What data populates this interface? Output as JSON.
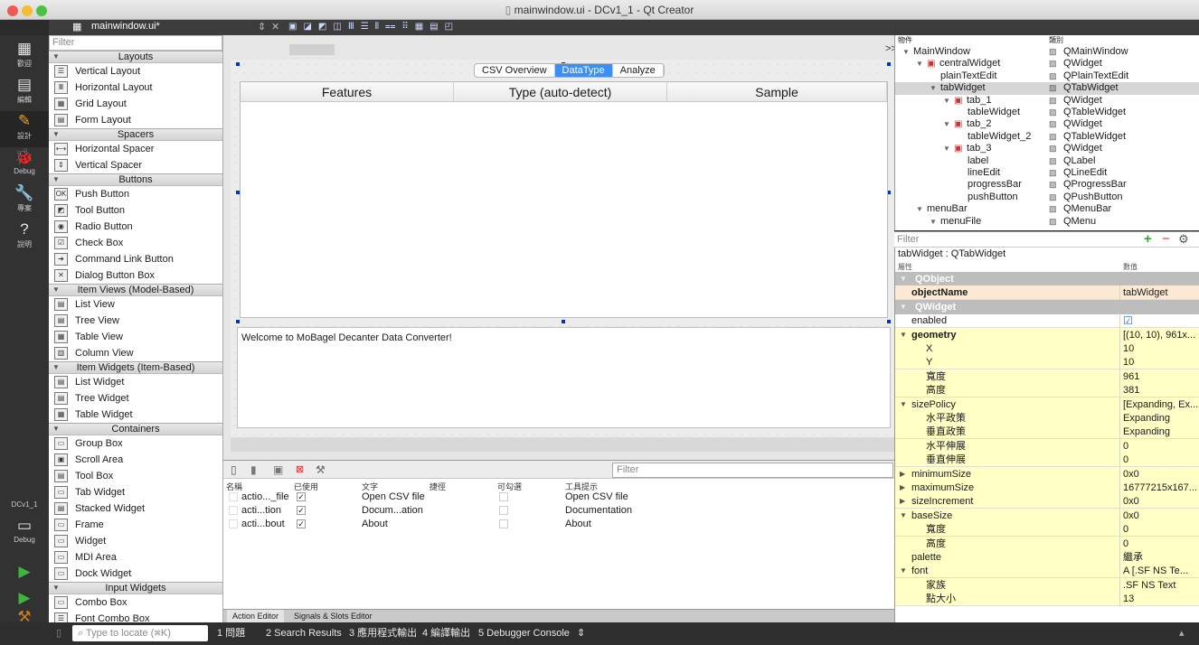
{
  "window": {
    "title": "mainwindow.ui - DCv1_1 - Qt Creator"
  },
  "editor_toolbar": {
    "filename": "mainwindow.ui*",
    "arrows": "⇕",
    "close": "✕"
  },
  "modes": [
    {
      "icon": "grid-icon",
      "glyph": "▦",
      "label": "歡迎"
    },
    {
      "icon": "edit-icon",
      "glyph": "▤",
      "label": "編輯"
    },
    {
      "icon": "design-icon",
      "glyph": "✎",
      "label": "設計"
    },
    {
      "icon": "debug-icon",
      "glyph": "🐞",
      "label": "Debug"
    },
    {
      "icon": "project-icon",
      "glyph": "🔧",
      "label": "專案"
    },
    {
      "icon": "help-icon",
      "glyph": "?",
      "label": "說明"
    }
  ],
  "kit": {
    "name": "DCv1_1",
    "mode": "Debug"
  },
  "widget_box": {
    "filter_placeholder": "Filter",
    "sections": [
      {
        "title": "Layouts",
        "items": [
          "Vertical Layout",
          "Horizontal Layout",
          "Grid Layout",
          "Form Layout"
        ]
      },
      {
        "title": "Spacers",
        "items": [
          "Horizontal Spacer",
          "Vertical Spacer"
        ]
      },
      {
        "title": "Buttons",
        "items": [
          "Push Button",
          "Tool Button",
          "Radio Button",
          "Check Box",
          "Command Link Button",
          "Dialog Button Box"
        ]
      },
      {
        "title": "Item Views (Model-Based)",
        "items": [
          "List View",
          "Tree View",
          "Table View",
          "Column View"
        ]
      },
      {
        "title": "Item Widgets (Item-Based)",
        "items": [
          "List Widget",
          "Tree Widget",
          "Table Widget"
        ]
      },
      {
        "title": "Containers",
        "items": [
          "Group Box",
          "Scroll Area",
          "Tool Box",
          "Tab Widget",
          "Stacked Widget",
          "Frame",
          "Widget",
          "MDI Area",
          "Dock Widget"
        ]
      },
      {
        "title": "Input Widgets",
        "items": [
          "Combo Box",
          "Font Combo Box"
        ]
      }
    ]
  },
  "form": {
    "tabs": [
      "CSV Overview",
      "DataType",
      "Analyze"
    ],
    "active_tab": "DataType",
    "table_headers": [
      "Features",
      "Type (auto-detect)",
      "Sample"
    ],
    "text_edit": "Welcome to MoBagel Decanter Data Converter!",
    "expand_arrow": ">>"
  },
  "action_editor": {
    "filter_placeholder": "Filter",
    "headers": [
      "名稱",
      "已使用",
      "文字",
      "捷徑",
      "可勾選",
      "工具提示"
    ],
    "rows": [
      {
        "name": "actio..._file",
        "used": "✓",
        "text": "Open CSV file",
        "tooltip": "Open CSV file"
      },
      {
        "name": "acti...tion",
        "used": "✓",
        "text": "Docum...ation",
        "tooltip": "Documentation"
      },
      {
        "name": "acti...bout",
        "used": "✓",
        "text": "About",
        "tooltip": "About"
      }
    ],
    "tabs": [
      "Action Editor",
      "Signals & Slots Editor"
    ]
  },
  "object_inspector": {
    "headers": [
      "物件",
      "類別"
    ],
    "rows": [
      {
        "name": "MainWindow",
        "cls": "QMainWindow",
        "depth": 0,
        "arrow": "▼"
      },
      {
        "name": "centralWidget",
        "cls": "QWidget",
        "depth": 1,
        "arrow": "▼"
      },
      {
        "name": "plainTextEdit",
        "cls": "QPlainTextEdit",
        "depth": 2,
        "arrow": ""
      },
      {
        "name": "tabWidget",
        "cls": "QTabWidget",
        "depth": 2,
        "arrow": "▼"
      },
      {
        "name": "tab_1",
        "cls": "QWidget",
        "depth": 3,
        "arrow": "▼"
      },
      {
        "name": "tableWidget",
        "cls": "QTableWidget",
        "depth": 4,
        "arrow": ""
      },
      {
        "name": "tab_2",
        "cls": "QWidget",
        "depth": 3,
        "arrow": "▼"
      },
      {
        "name": "tableWidget_2",
        "cls": "QTableWidget",
        "depth": 4,
        "arrow": ""
      },
      {
        "name": "tab_3",
        "cls": "QWidget",
        "depth": 3,
        "arrow": "▼"
      },
      {
        "name": "label",
        "cls": "QLabel",
        "depth": 4,
        "arrow": ""
      },
      {
        "name": "lineEdit",
        "cls": "QLineEdit",
        "depth": 4,
        "arrow": ""
      },
      {
        "name": "progressBar",
        "cls": "QProgressBar",
        "depth": 4,
        "arrow": ""
      },
      {
        "name": "pushButton",
        "cls": "QPushButton",
        "depth": 4,
        "arrow": ""
      },
      {
        "name": "menuBar",
        "cls": "QMenuBar",
        "depth": 1,
        "arrow": "▼"
      },
      {
        "name": "menuFile",
        "cls": "QMenu",
        "depth": 2,
        "arrow": "▼"
      }
    ],
    "selected": "tabWidget"
  },
  "property_editor": {
    "filter_placeholder": "Filter",
    "add": "+",
    "remove": "−",
    "wrench": "⚙",
    "title": "tabWidget : QTabWidget",
    "headers": [
      "屬性",
      "數值"
    ],
    "rows": [
      {
        "kind": "cat",
        "name": "QObject",
        "value": ""
      },
      {
        "kind": "ob",
        "name": "objectName",
        "value": "tabWidget",
        "bold": true
      },
      {
        "kind": "cat",
        "name": "QWidget",
        "value": ""
      },
      {
        "kind": "w",
        "name": "enabled",
        "value": "☑"
      },
      {
        "kind": "y",
        "name": "geometry",
        "value": "[(10, 10), 961x...",
        "bold": true,
        "arrow": "▼"
      },
      {
        "kind": "y",
        "name": "X",
        "value": "10",
        "indent": 1
      },
      {
        "kind": "y",
        "name": "Y",
        "value": "10",
        "indent": 1
      },
      {
        "kind": "y",
        "name": "寬度",
        "value": "961",
        "indent": 1
      },
      {
        "kind": "y",
        "name": "高度",
        "value": "381",
        "indent": 1
      },
      {
        "kind": "y",
        "name": "sizePolicy",
        "value": "[Expanding, Ex...",
        "arrow": "▼"
      },
      {
        "kind": "y",
        "name": "水平政策",
        "value": "Expanding",
        "indent": 1
      },
      {
        "kind": "y",
        "name": "垂直政策",
        "value": "Expanding",
        "indent": 1
      },
      {
        "kind": "y",
        "name": "水平伸展",
        "value": "0",
        "indent": 1
      },
      {
        "kind": "y",
        "name": "垂直伸展",
        "value": "0",
        "indent": 1
      },
      {
        "kind": "y",
        "name": "minimumSize",
        "value": "0x0",
        "arrow": "▶"
      },
      {
        "kind": "y",
        "name": "maximumSize",
        "value": "16777215x167...",
        "arrow": "▶"
      },
      {
        "kind": "y",
        "name": "sizeIncrement",
        "value": "0x0",
        "arrow": "▶"
      },
      {
        "kind": "y",
        "name": "baseSize",
        "value": "0x0",
        "arrow": "▼"
      },
      {
        "kind": "y",
        "name": "寬度",
        "value": "0",
        "indent": 1
      },
      {
        "kind": "y",
        "name": "高度",
        "value": "0",
        "indent": 1
      },
      {
        "kind": "y",
        "name": "palette",
        "value": "繼承"
      },
      {
        "kind": "y",
        "name": "font",
        "value": "A  [.SF NS Te...",
        "arrow": "▼"
      },
      {
        "kind": "y",
        "name": "家族",
        "value": ".SF NS Text",
        "indent": 1
      },
      {
        "kind": "y",
        "name": "點大小",
        "value": "13",
        "indent": 1
      }
    ]
  },
  "statusbar": {
    "locate_placeholder": "Type to locate (⌘K)",
    "items": [
      "1 問題",
      "2 Search Results",
      "3 應用程式輸出",
      "4 編譯輸出",
      "5 Debugger Console"
    ],
    "issues_badge": "1",
    "arrows": "⇕"
  }
}
